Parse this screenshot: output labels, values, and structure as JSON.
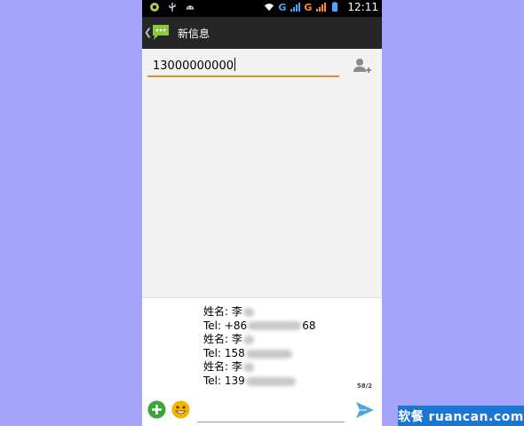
{
  "status_bar": {
    "icons_left": [
      "android-notification-icon",
      "usb-icon",
      "android-robot-icon"
    ],
    "network_1": "G",
    "network_2": "G",
    "time": "12:11"
  },
  "action_bar": {
    "title": "新信息"
  },
  "recipient": {
    "value": "13000000000"
  },
  "message": {
    "lines": [
      {
        "prefix": "姓名: 李",
        "suffix": ""
      },
      {
        "prefix": "Tel: +86",
        "suffix": "68"
      },
      {
        "prefix": "姓名: 李",
        "suffix": ""
      },
      {
        "prefix": "Tel: 158",
        "suffix": ""
      },
      {
        "prefix": "姓名: 李",
        "suffix": ""
      },
      {
        "prefix": "Tel: 139",
        "suffix": ""
      }
    ],
    "counter": "58/2"
  },
  "compose": {
    "placeholder": ""
  },
  "watermark": "软餐 ruancan.com",
  "colors": {
    "background": "#a3a3fb",
    "accent_underline": "#e08a2c",
    "send": "#4ea7d8",
    "add_green": "#3aa53a"
  }
}
